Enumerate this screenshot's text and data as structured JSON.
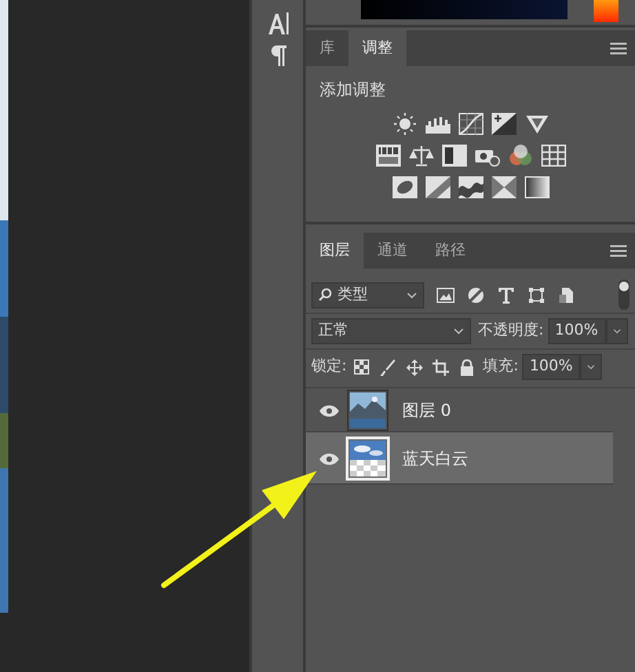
{
  "top_tabs": [
    {
      "label": "库",
      "selected": false
    },
    {
      "label": "调整",
      "selected": true
    }
  ],
  "adjustments": {
    "title": "添加调整"
  },
  "layer_tabs": [
    {
      "label": "图层",
      "selected": true
    },
    {
      "label": "通道",
      "selected": false
    },
    {
      "label": "路径",
      "selected": false
    }
  ],
  "filter": {
    "value": "类型"
  },
  "blend": {
    "value": "正常",
    "opacity_label": "不透明度:",
    "opacity": "100%"
  },
  "lock": {
    "label": "锁定:",
    "fill_label": "填充:",
    "fill": "100%"
  },
  "layers": [
    {
      "name": "图层 0",
      "visible": true,
      "selected": false
    },
    {
      "name": "蓝天白云",
      "visible": true,
      "selected": true,
      "kind": "masked"
    }
  ]
}
